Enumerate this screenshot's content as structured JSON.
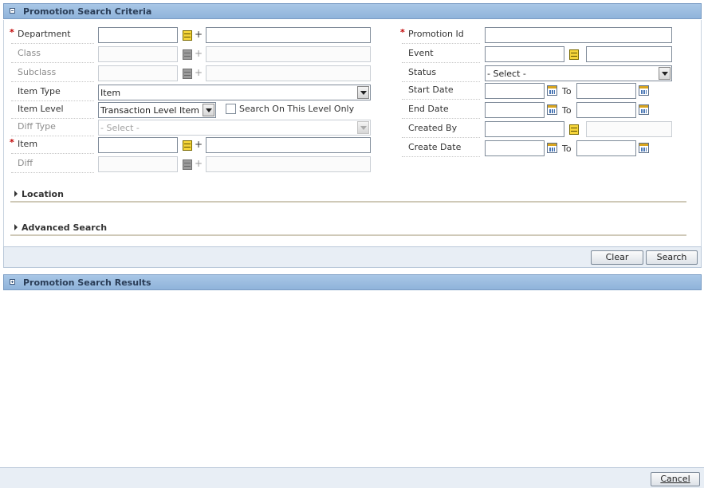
{
  "criteria_panel": {
    "title": "Promotion Search Criteria"
  },
  "results_panel": {
    "title": "Promotion Search Results"
  },
  "left_fields": {
    "department": {
      "label": "Department"
    },
    "class": {
      "label": "Class"
    },
    "subclass": {
      "label": "Subclass"
    },
    "item_type": {
      "label": "Item Type",
      "value": "Item"
    },
    "item_level": {
      "label": "Item Level",
      "value": "Transaction Level Item"
    },
    "search_on_level": {
      "label": "Search On This Level Only",
      "checked": false
    },
    "diff_type": {
      "label": "Diff Type",
      "value": "- Select -"
    },
    "item": {
      "label": "Item"
    },
    "diff": {
      "label": "Diff"
    }
  },
  "right_fields": {
    "promotion_id": {
      "label": "Promotion Id"
    },
    "event": {
      "label": "Event"
    },
    "status": {
      "label": "Status",
      "value": "- Select -"
    },
    "start_date": {
      "label": "Start Date",
      "to": "To"
    },
    "end_date": {
      "label": "End Date",
      "to": "To"
    },
    "created_by": {
      "label": "Created By"
    },
    "create_date": {
      "label": "Create Date",
      "to": "To"
    }
  },
  "required_marker": "*",
  "plus_symbol": "+",
  "sections": {
    "location": "Location",
    "advanced_search": "Advanced Search"
  },
  "buttons": {
    "clear": "Clear",
    "search": "Search",
    "cancel": "Cancel"
  },
  "colors": {
    "panel_header": "#9dbde0",
    "required": "#c00000",
    "button_bar": "#e8eef5"
  },
  "icons": [
    "collapse-icon",
    "expand-icon",
    "lov-icon",
    "calendar-icon",
    "triangle-right-icon"
  ]
}
